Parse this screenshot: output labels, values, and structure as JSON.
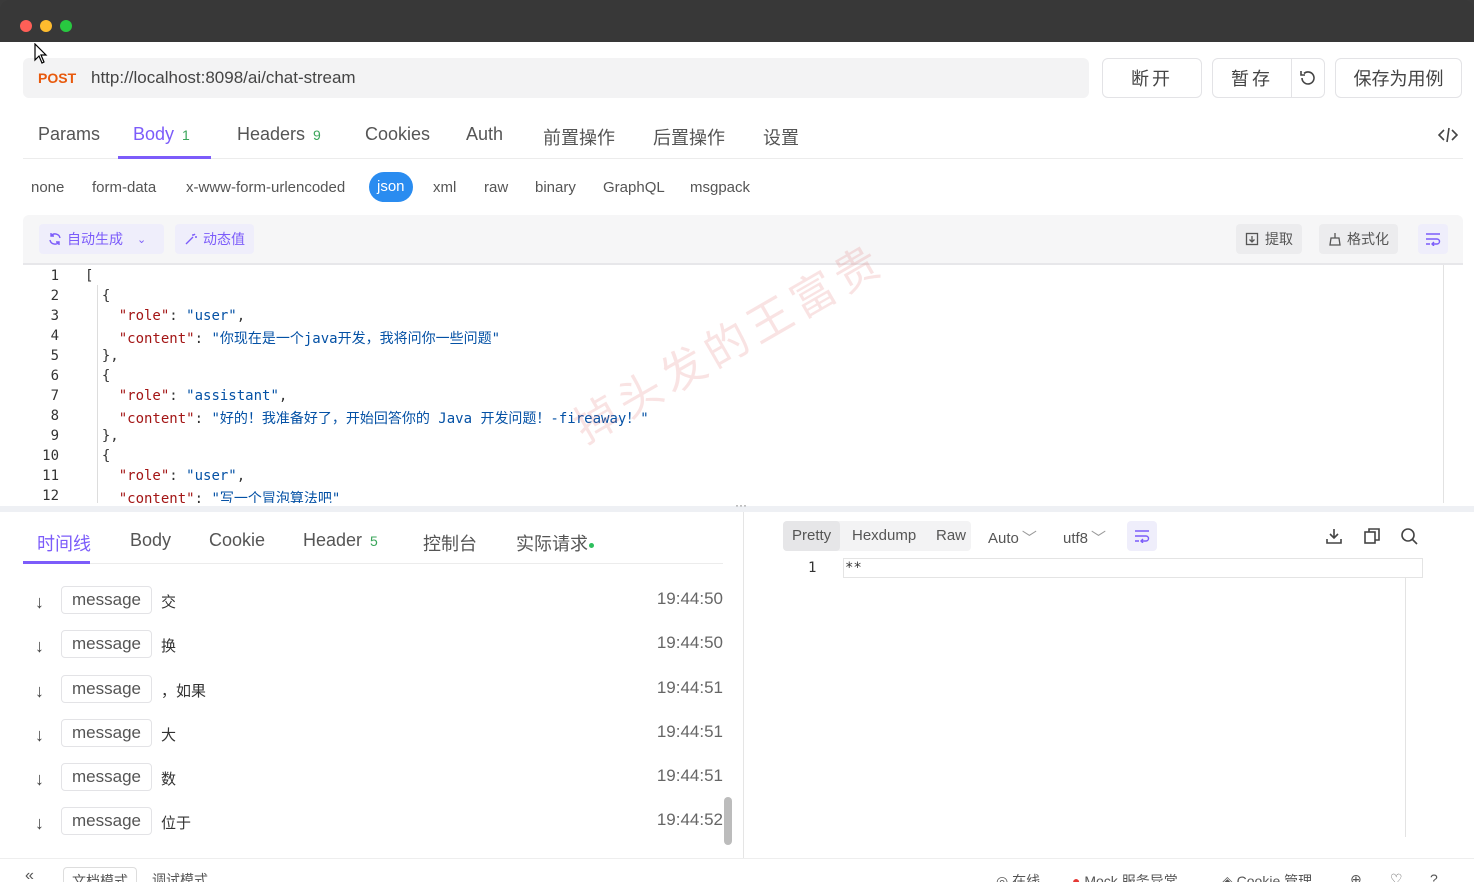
{
  "window": {
    "dots": [
      "#ff5f57",
      "#febc2e",
      "#28c840"
    ]
  },
  "request": {
    "method": "POST",
    "url": "http://localhost:8098/ai/chat-stream"
  },
  "actions": {
    "disconnect": "断开",
    "stash": "暂存",
    "save_case": "保存为用例"
  },
  "tabs": [
    {
      "label": "Params"
    },
    {
      "label": "Body",
      "count": "1"
    },
    {
      "label": "Headers",
      "count": "9"
    },
    {
      "label": "Cookies"
    },
    {
      "label": "Auth"
    },
    {
      "label": "前置操作"
    },
    {
      "label": "后置操作"
    },
    {
      "label": "设置"
    }
  ],
  "body_types": [
    "none",
    "form-data",
    "x-www-form-urlencoded",
    "json",
    "xml",
    "raw",
    "binary",
    "GraphQL",
    "msgpack"
  ],
  "editor_toolbar": {
    "auto_generate": "自动生成",
    "dynamic_value": "动态值",
    "extract": "提取",
    "format": "格式化"
  },
  "code": {
    "line_numbers": [
      "1",
      "2",
      "3",
      "4",
      "5",
      "6",
      "7",
      "8",
      "9",
      "10",
      "11",
      "12"
    ],
    "open_bracket": "[",
    "open_brace": "{",
    "close_brace": "},",
    "colon": ": ",
    "comma": ",",
    "key_role": "\"role\"",
    "key_content": "\"content\"",
    "msg1_role": "\"user\"",
    "msg1_content": "\"你现在是一个java开发，我将问你一些问题\"",
    "msg2_role": "\"assistant\"",
    "msg2_content": "\"好的！我准备好了，开始回答你的 Java 开发问题！-fireaway！\"",
    "msg3_role": "\"user\"",
    "msg3_content": "\"写一个冒泡算法吧\""
  },
  "response_tabs": [
    {
      "label": "时间线"
    },
    {
      "label": "Body"
    },
    {
      "label": "Cookie"
    },
    {
      "label": "Header",
      "count": "5"
    },
    {
      "label": "控制台"
    },
    {
      "label": "实际请求"
    }
  ],
  "messages": [
    {
      "type": "message",
      "text": "交",
      "time": "19:44:50"
    },
    {
      "type": "message",
      "text": "换",
      "time": "19:44:50"
    },
    {
      "type": "message",
      "text": "，如果",
      "time": "19:44:51"
    },
    {
      "type": "message",
      "text": "大",
      "time": "19:44:51"
    },
    {
      "type": "message",
      "text": "数",
      "time": "19:44:51"
    },
    {
      "type": "message",
      "text": "位于",
      "time": "19:44:52"
    }
  ],
  "viewer": {
    "modes": [
      "Pretty",
      "Hexdump",
      "Raw"
    ],
    "auto": "Auto",
    "encoding": "utf8",
    "line_number": "1",
    "content": "**"
  },
  "footer": {
    "doc_mode": "文档模式",
    "debug_mode": "调试模式",
    "online": "在线",
    "mock": "Mock 服务异常",
    "cookie": "Cookie 管理"
  },
  "watermark": "掉头发的王富贵",
  "colors": {
    "accent": "#7c5cfa",
    "json_active": "#2a8cf0",
    "method": "#e8590c",
    "count": "#3aa55a"
  }
}
